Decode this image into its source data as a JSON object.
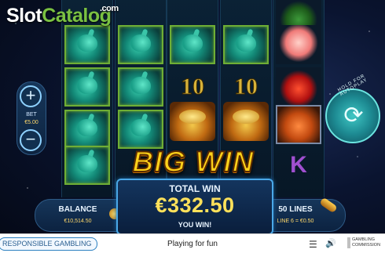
{
  "watermark": {
    "part1": "Slot",
    "part2": "Catalog",
    "part3": ".com"
  },
  "controls": {
    "bet_label": "BET",
    "bet_value": "€5.00",
    "plus_symbol": "+",
    "minus_symbol": "−",
    "autoplay_label": "HOLD FOR AUTOPLAY",
    "spin_symbol": "⟳"
  },
  "reels": {
    "symbols": [
      [
        "hare",
        "hare",
        "hare",
        "hare"
      ],
      [
        "hare",
        "hare",
        "hare",
        "hare"
      ],
      [
        "hare",
        "ten",
        "crab",
        "bonus"
      ],
      [
        "hare",
        "ten",
        "crab",
        "bonus"
      ],
      [
        "leafs",
        "peach",
        "apple",
        "fox",
        "K"
      ]
    ],
    "ten_text": "10",
    "k_text": "K"
  },
  "big_win": "BIG WIN",
  "win_panel": {
    "title": "TOTAL WIN",
    "amount": "€332.50",
    "message": "YOU WIN!"
  },
  "info_bar": {
    "balance_label": "BALANCE",
    "balance_value": "€10,514.50",
    "lines_label": "50 LINES",
    "line_value": "LINE 6 = €0.50"
  },
  "footer": {
    "responsible": "RESPONSIBLE GAMBLING",
    "playing": "Playing for fun",
    "menu_icon": "☰",
    "sound_icon": "🔊",
    "gc_line1": "GAMBLING",
    "gc_line2": "COMMISSION"
  },
  "colors": {
    "accent": "#4aa8e8",
    "win_gold": "#ffe15a",
    "logo_green": "#7ac142"
  }
}
